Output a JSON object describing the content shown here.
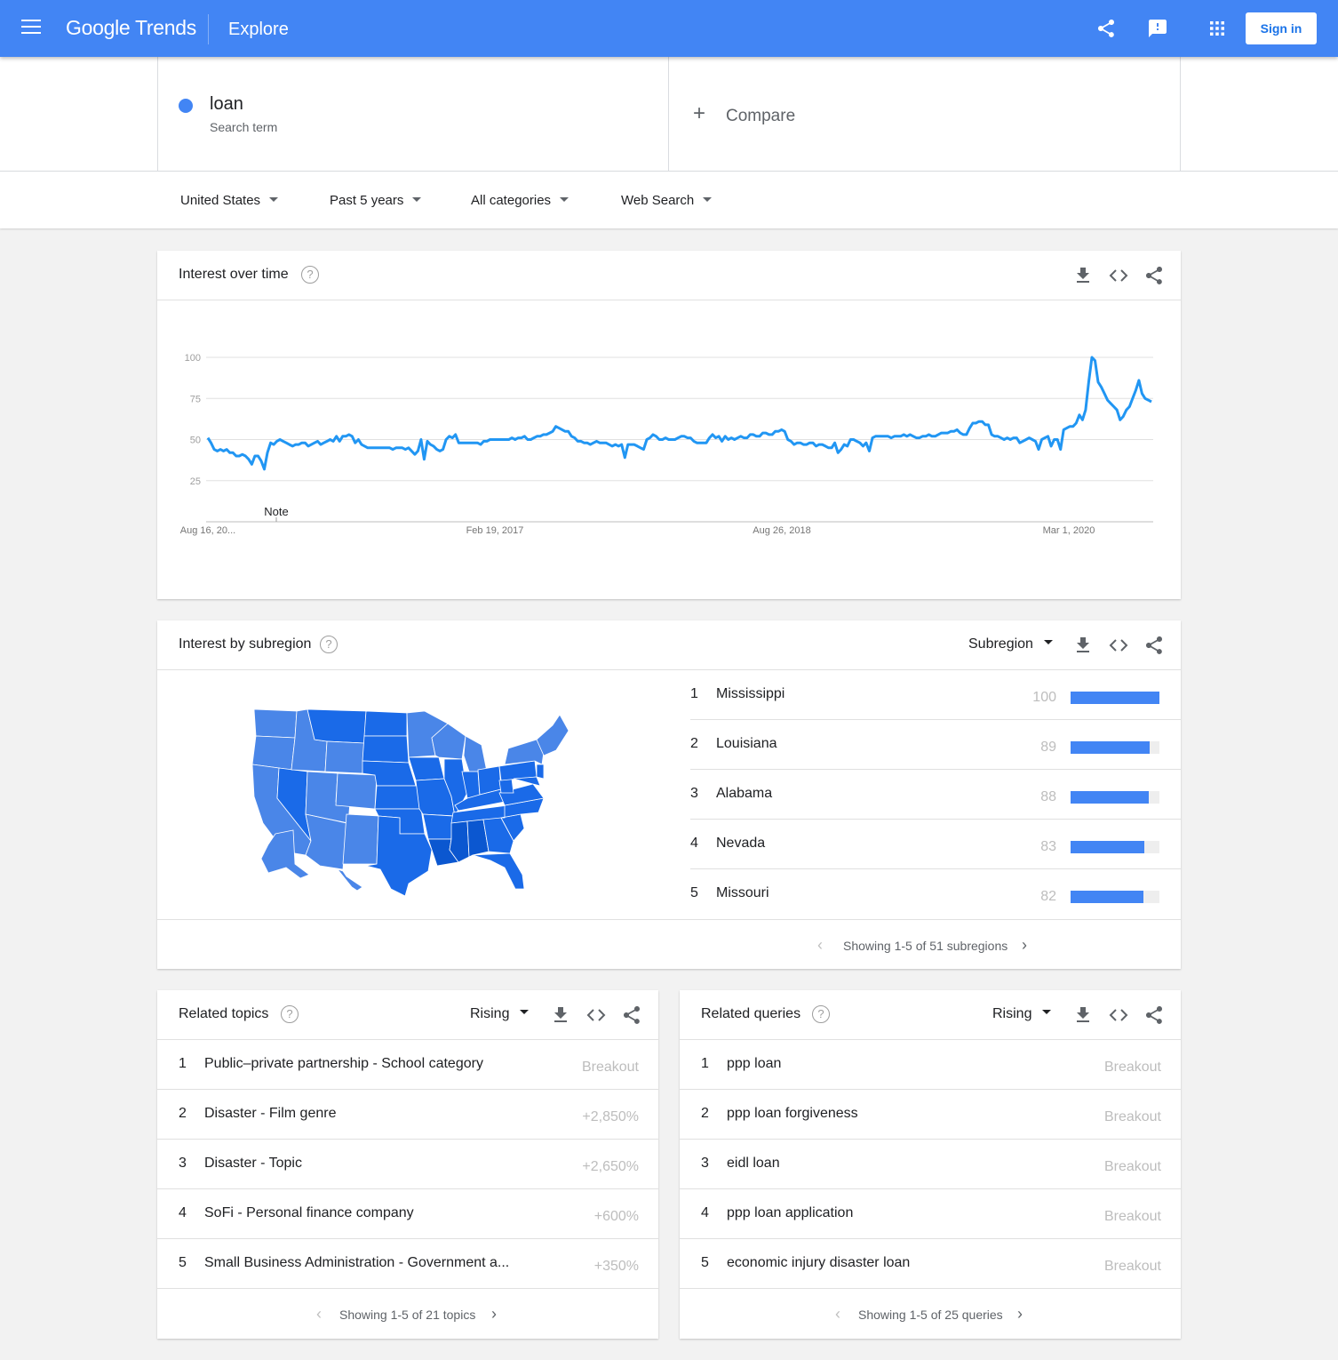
{
  "header": {
    "logo": "Google Trends",
    "section": "Explore",
    "sign_in": "Sign in"
  },
  "search": {
    "term": "loan",
    "term_type": "Search term",
    "compare_label": "Compare",
    "term_color": "#4285f4"
  },
  "filters": {
    "region": "United States",
    "time": "Past 5 years",
    "category": "All categories",
    "property": "Web Search"
  },
  "interest_over_time": {
    "title": "Interest over time",
    "note": "Note"
  },
  "chart_data": {
    "type": "line",
    "series": [
      {
        "values": [
          51,
          48,
          44,
          43,
          44,
          43,
          44,
          42,
          42,
          40,
          40,
          41,
          40,
          38,
          35,
          40,
          40,
          37,
          32,
          42,
          48,
          47,
          49,
          50,
          49,
          48,
          47,
          46,
          47,
          47,
          48,
          48,
          46,
          47,
          48,
          49,
          47,
          48,
          49,
          50,
          49,
          52,
          49,
          52,
          52,
          53,
          52,
          48,
          50,
          47,
          46,
          45,
          45,
          45,
          45,
          45,
          45,
          45,
          45,
          44,
          45,
          45,
          45,
          44,
          45,
          43,
          41,
          43,
          50,
          38,
          49,
          47,
          46,
          44,
          43,
          44,
          50,
          52,
          51,
          53,
          48,
          48,
          48,
          48,
          48,
          48,
          48,
          47,
          49,
          49,
          50,
          50,
          50,
          50,
          50,
          50,
          50,
          51,
          50,
          51,
          51,
          52,
          50,
          50,
          51,
          52,
          52,
          53,
          53,
          54,
          55,
          58,
          57,
          56,
          55,
          55,
          52,
          51,
          49,
          49,
          48,
          48,
          47,
          48,
          49,
          48,
          48,
          48,
          47,
          46,
          47,
          46,
          47,
          39,
          47,
          47,
          47,
          46,
          45,
          44,
          50,
          51,
          53,
          52,
          50,
          50,
          51,
          50,
          50,
          50,
          51,
          52,
          52,
          51,
          51,
          49,
          48,
          48,
          48,
          48,
          51,
          53,
          51,
          52,
          49,
          52,
          50,
          51,
          50,
          51,
          52,
          51,
          51,
          53,
          53,
          52,
          52,
          54,
          54,
          53,
          53,
          55,
          55,
          56,
          55,
          50,
          49,
          47,
          48,
          48,
          47,
          47,
          48,
          48,
          46,
          47,
          47,
          46,
          45,
          45,
          48,
          42,
          44,
          47,
          46,
          50,
          50,
          49,
          48,
          46,
          48,
          43,
          51,
          52,
          52,
          52,
          52,
          52,
          51,
          52,
          52,
          52,
          53,
          52,
          53,
          52,
          51,
          51,
          52,
          52,
          53,
          52,
          52,
          53,
          54,
          54,
          54,
          55,
          55,
          56,
          54,
          53,
          53,
          57,
          60,
          60,
          61,
          61,
          59,
          59,
          53,
          52,
          52,
          51,
          50,
          51,
          50,
          51,
          51,
          48,
          49,
          50,
          51,
          50,
          49,
          44,
          50,
          51,
          52,
          46,
          50,
          50,
          44,
          56,
          57,
          58,
          58,
          60,
          65,
          62,
          68,
          85,
          100,
          98,
          85,
          82,
          78,
          74,
          72,
          70,
          68,
          62,
          64,
          68,
          70,
          75,
          80,
          86,
          78,
          75,
          74,
          73
        ],
        "color": "#2196f3"
      }
    ],
    "x_tick_labels": [
      "Aug 16, 20...",
      "Feb 19, 2017",
      "Aug 26, 2018",
      "Mar 1, 2020"
    ],
    "y_ticks": [
      25,
      50,
      75,
      100
    ],
    "ylim": [
      0,
      100
    ],
    "grid": true,
    "annotations": [
      "Note"
    ]
  },
  "subregion": {
    "title": "Interest by subregion",
    "selector": "Subregion",
    "rows": [
      {
        "rank": "1",
        "name": "Mississippi",
        "value": "100",
        "fraction": 1.0
      },
      {
        "rank": "2",
        "name": "Louisiana",
        "value": "89",
        "fraction": 0.89
      },
      {
        "rank": "3",
        "name": "Alabama",
        "value": "88",
        "fraction": 0.88
      },
      {
        "rank": "4",
        "name": "Nevada",
        "value": "83",
        "fraction": 0.83
      },
      {
        "rank": "5",
        "name": "Missouri",
        "value": "82",
        "fraction": 0.82
      }
    ],
    "pager": "Showing 1-5 of 51 subregions",
    "map_colors": {
      "high": "#0b57d0",
      "mid": "#1a6ae8",
      "low": "#4a86e8"
    }
  },
  "related_topics": {
    "title": "Related topics",
    "selector": "Rising",
    "rows": [
      {
        "rank": "1",
        "name": "Public–private partnership - School category",
        "value": "Breakout"
      },
      {
        "rank": "2",
        "name": "Disaster - Film genre",
        "value": "+2,850%"
      },
      {
        "rank": "3",
        "name": "Disaster - Topic",
        "value": "+2,650%"
      },
      {
        "rank": "4",
        "name": "SoFi - Personal finance company",
        "value": "+600%"
      },
      {
        "rank": "5",
        "name": "Small Business Administration - Government a...",
        "value": "+350%"
      }
    ],
    "pager": "Showing 1-5 of 21 topics"
  },
  "related_queries": {
    "title": "Related queries",
    "selector": "Rising",
    "rows": [
      {
        "rank": "1",
        "name": "ppp loan",
        "value": "Breakout"
      },
      {
        "rank": "2",
        "name": "ppp loan forgiveness",
        "value": "Breakout"
      },
      {
        "rank": "3",
        "name": "eidl loan",
        "value": "Breakout"
      },
      {
        "rank": "4",
        "name": "ppp loan application",
        "value": "Breakout"
      },
      {
        "rank": "5",
        "name": "economic injury disaster loan",
        "value": "Breakout"
      }
    ],
    "pager": "Showing 1-5 of 25 queries"
  }
}
